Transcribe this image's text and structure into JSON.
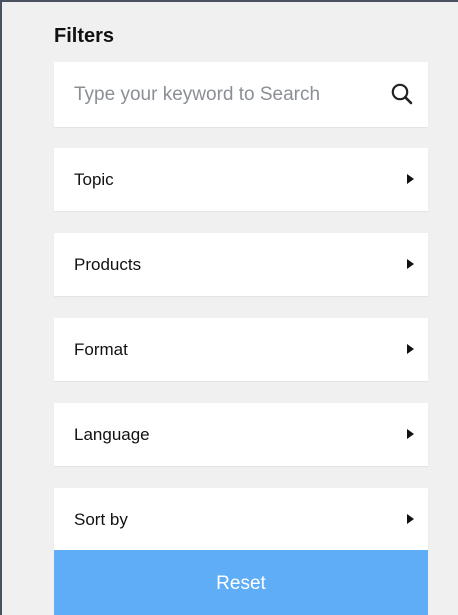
{
  "filters": {
    "title": "Filters",
    "search": {
      "placeholder": "Type your keyword to Search",
      "value": "",
      "icon": "search-icon"
    },
    "items": [
      {
        "label": "Topic",
        "icon": "caret-right-icon"
      },
      {
        "label": "Products",
        "icon": "caret-right-icon"
      },
      {
        "label": "Format",
        "icon": "caret-right-icon"
      },
      {
        "label": "Language",
        "icon": "caret-right-icon"
      },
      {
        "label": "Sort by",
        "icon": "caret-right-icon"
      }
    ],
    "reset_label": "Reset"
  },
  "colors": {
    "panel_background": "#f0f0f0",
    "card_background": "#ffffff",
    "reset_button": "#5fadf6",
    "text": "#111111",
    "placeholder": "#8a8f96"
  }
}
